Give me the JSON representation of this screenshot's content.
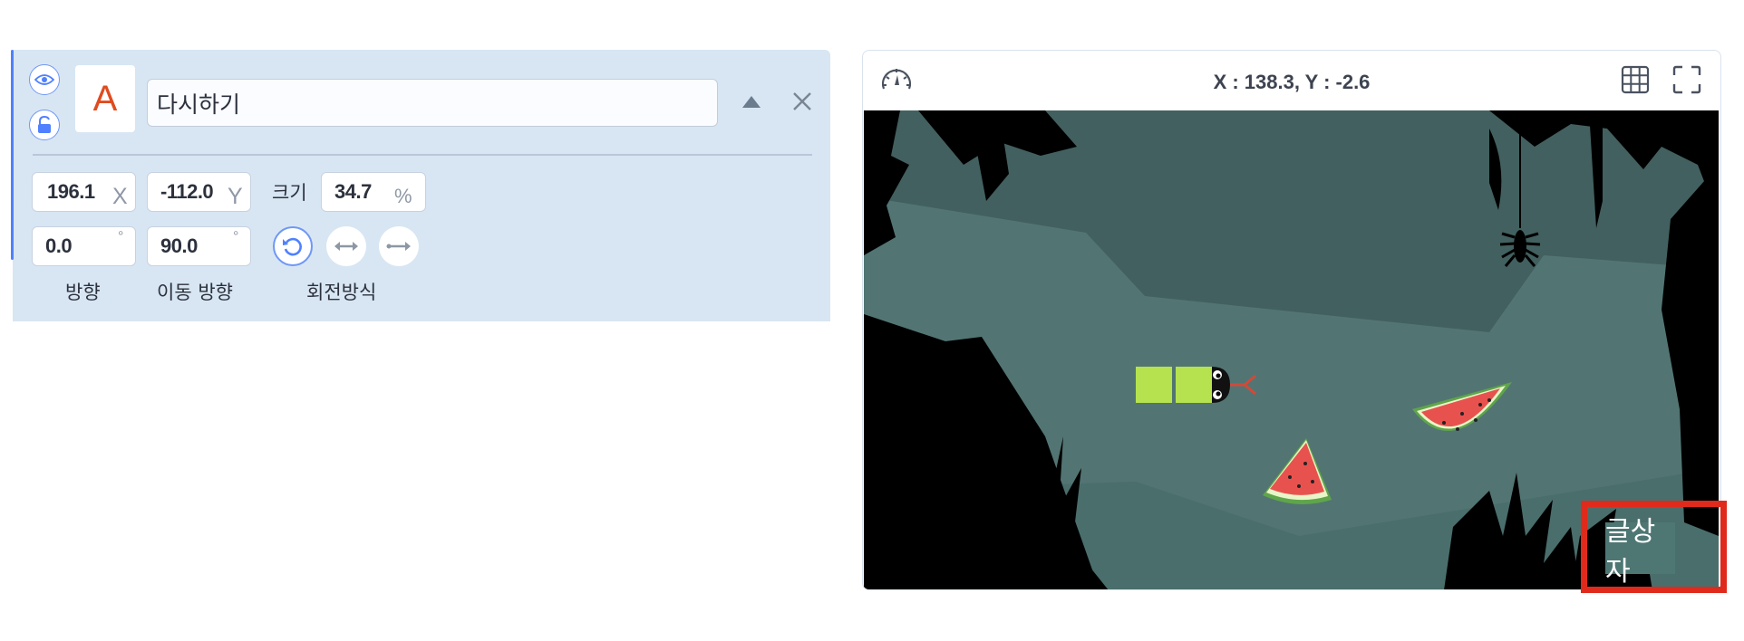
{
  "object_panel": {
    "thumbnail_letter": "A",
    "object_name": "다시하기",
    "position": {
      "x_value": "196.1",
      "x_unit": "X",
      "y_value": "-112.0",
      "y_unit": "Y"
    },
    "size": {
      "label": "크기",
      "value": "34.7",
      "unit": "%"
    },
    "direction": {
      "value": "0.0",
      "unit": "°",
      "label": "방향"
    },
    "move_direction": {
      "value": "90.0",
      "unit": "°",
      "label": "이동 방향"
    },
    "rotation": {
      "label": "회전방식"
    },
    "icons": {
      "visibility": "eye-icon",
      "lock": "lock-open-icon",
      "collapse": "triangle-up-icon",
      "delete": "close-icon",
      "rotate_free": "rotate-icon",
      "rotate_horizontal": "horizontal-arrows-icon",
      "rotate_none": "arrow-right-icon"
    }
  },
  "stage": {
    "coordinates": "X : 138.3, Y : -2.6",
    "icons": {
      "speed": "speedometer-icon",
      "grid": "grid-icon",
      "fullscreen": "fullscreen-icon"
    },
    "textbox_label": "글상자",
    "colors": {
      "highlight": "#e02a1c",
      "cave_bg": "#42605f",
      "cave_mid": "#527573",
      "cave_floor": "#4a6e6c",
      "silhouette": "#000000"
    }
  }
}
